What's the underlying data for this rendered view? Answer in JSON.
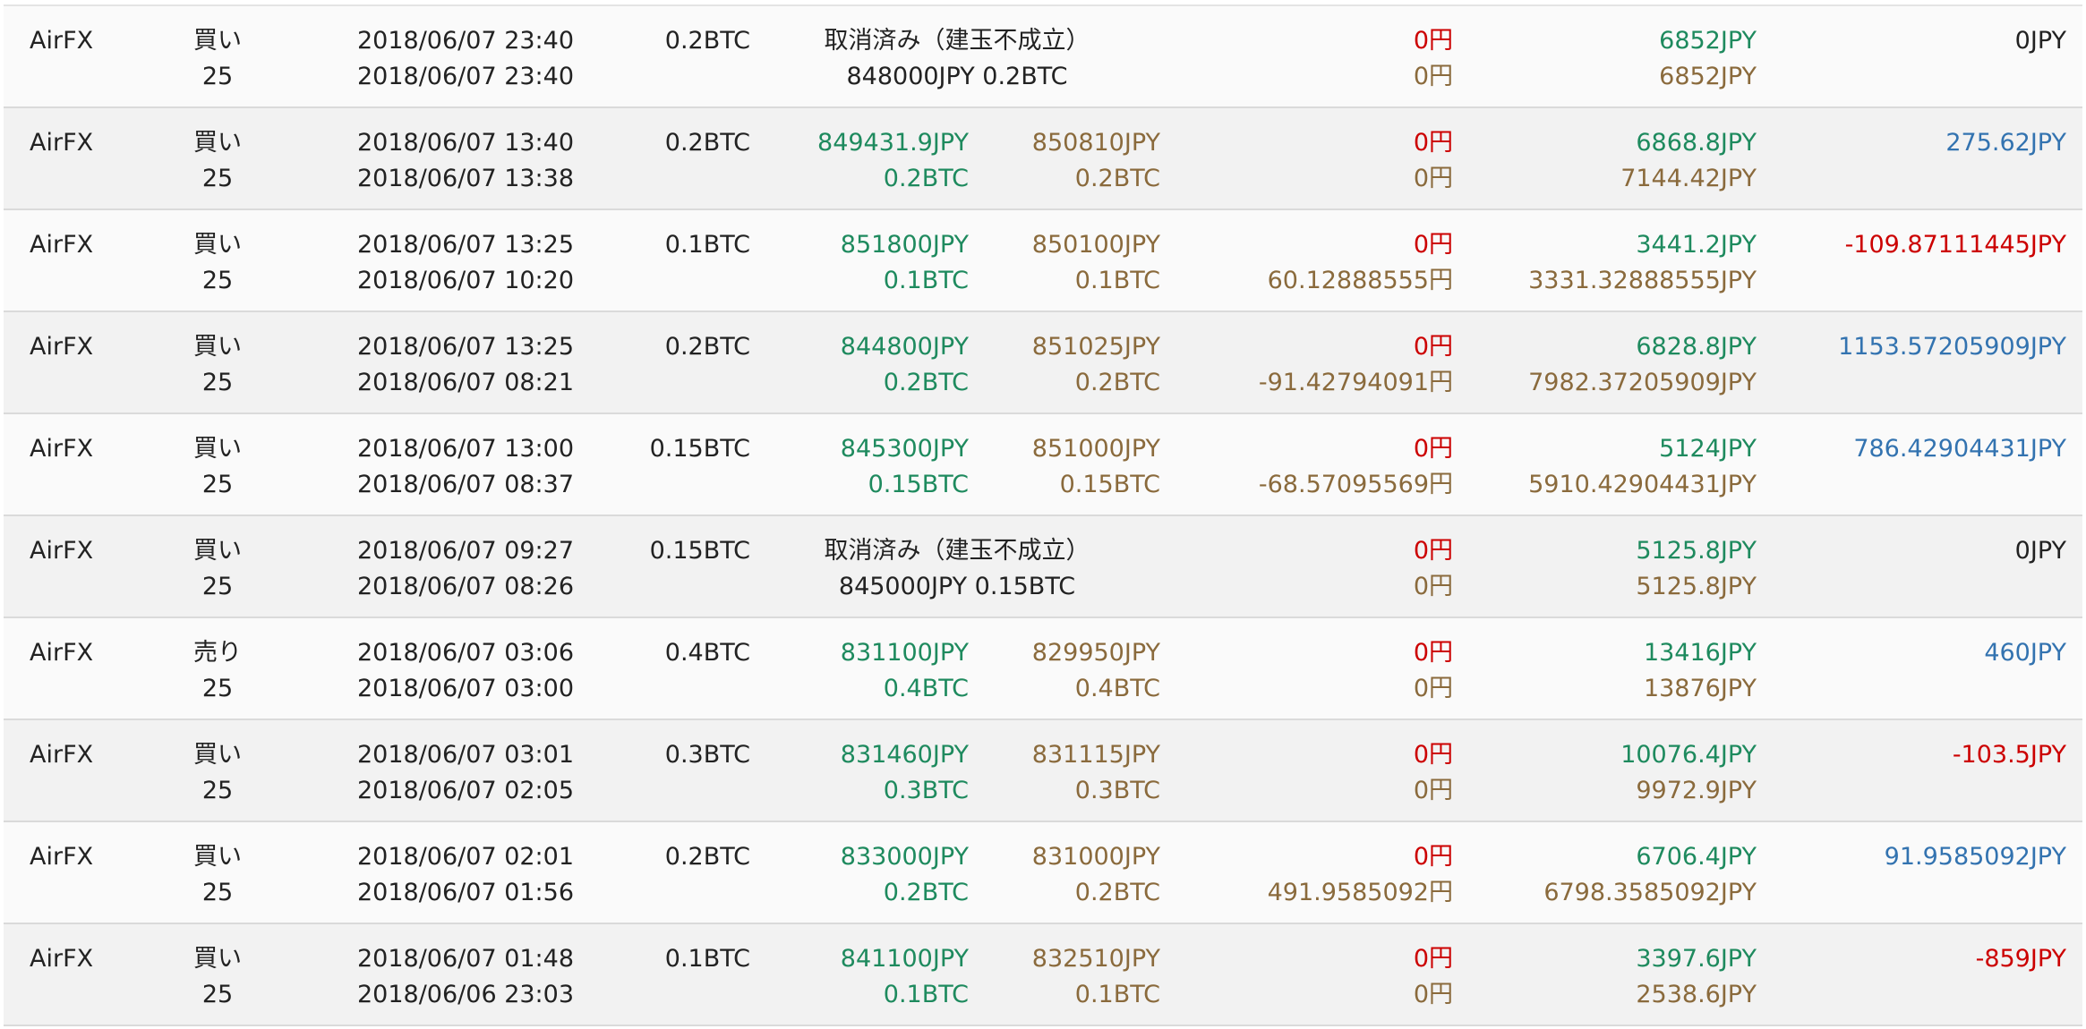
{
  "colors": {
    "open": "#1e8a5e",
    "close": "#8a6a3c",
    "loss": "#cc0000",
    "profit": "#3373b0",
    "neutral": "#222222"
  },
  "rows": [
    {
      "exchange": "AirFX",
      "side": "買い",
      "leverage": "25",
      "date1": "2018/06/07 23:40",
      "date2": "2018/06/07 23:40",
      "amount": "0.2BTC",
      "cancelled": true,
      "cancel_text": "取消済み（建玉不成立）",
      "cancel_detail": "848000JPY 0.2BTC",
      "fee1": "0円",
      "fee2": "0円",
      "margin1": "6852JPY",
      "margin2": "6852JPY",
      "pl": "0JPY",
      "pl_color": "black"
    },
    {
      "exchange": "AirFX",
      "side": "買い",
      "leverage": "25",
      "date1": "2018/06/07 13:40",
      "date2": "2018/06/07 13:38",
      "amount": "0.2BTC",
      "cancelled": false,
      "open_price": "849431.9JPY",
      "open_amt": "0.2BTC",
      "close_price": "850810JPY",
      "close_amt": "0.2BTC",
      "fee1": "0円",
      "fee2": "0円",
      "margin1": "6868.8JPY",
      "margin2": "7144.42JPY",
      "pl": "275.62JPY",
      "pl_color": "blue"
    },
    {
      "exchange": "AirFX",
      "side": "買い",
      "leverage": "25",
      "date1": "2018/06/07 13:25",
      "date2": "2018/06/07 10:20",
      "amount": "0.1BTC",
      "cancelled": false,
      "open_price": "851800JPY",
      "open_amt": "0.1BTC",
      "close_price": "850100JPY",
      "close_amt": "0.1BTC",
      "fee1": "0円",
      "fee2": "60.12888555円",
      "margin1": "3441.2JPY",
      "margin2": "3331.32888555JPY",
      "pl": "-109.87111445JPY",
      "pl_color": "red"
    },
    {
      "exchange": "AirFX",
      "side": "買い",
      "leverage": "25",
      "date1": "2018/06/07 13:25",
      "date2": "2018/06/07 08:21",
      "amount": "0.2BTC",
      "cancelled": false,
      "open_price": "844800JPY",
      "open_amt": "0.2BTC",
      "close_price": "851025JPY",
      "close_amt": "0.2BTC",
      "fee1": "0円",
      "fee2": "-91.42794091円",
      "margin1": "6828.8JPY",
      "margin2": "7982.37205909JPY",
      "pl": "1153.57205909JPY",
      "pl_color": "blue"
    },
    {
      "exchange": "AirFX",
      "side": "買い",
      "leverage": "25",
      "date1": "2018/06/07 13:00",
      "date2": "2018/06/07 08:37",
      "amount": "0.15BTC",
      "cancelled": false,
      "open_price": "845300JPY",
      "open_amt": "0.15BTC",
      "close_price": "851000JPY",
      "close_amt": "0.15BTC",
      "fee1": "0円",
      "fee2": "-68.57095569円",
      "margin1": "5124JPY",
      "margin2": "5910.42904431JPY",
      "pl": "786.42904431JPY",
      "pl_color": "blue"
    },
    {
      "exchange": "AirFX",
      "side": "買い",
      "leverage": "25",
      "date1": "2018/06/07 09:27",
      "date2": "2018/06/07 08:26",
      "amount": "0.15BTC",
      "cancelled": true,
      "cancel_text": "取消済み（建玉不成立）",
      "cancel_detail": "845000JPY 0.15BTC",
      "fee1": "0円",
      "fee2": "0円",
      "margin1": "5125.8JPY",
      "margin2": "5125.8JPY",
      "pl": "0JPY",
      "pl_color": "black"
    },
    {
      "exchange": "AirFX",
      "side": "売り",
      "leverage": "25",
      "date1": "2018/06/07 03:06",
      "date2": "2018/06/07 03:00",
      "amount": "0.4BTC",
      "cancelled": false,
      "open_price": "831100JPY",
      "open_amt": "0.4BTC",
      "close_price": "829950JPY",
      "close_amt": "0.4BTC",
      "fee1": "0円",
      "fee2": "0円",
      "margin1": "13416JPY",
      "margin2": "13876JPY",
      "pl": "460JPY",
      "pl_color": "blue"
    },
    {
      "exchange": "AirFX",
      "side": "買い",
      "leverage": "25",
      "date1": "2018/06/07 03:01",
      "date2": "2018/06/07 02:05",
      "amount": "0.3BTC",
      "cancelled": false,
      "open_price": "831460JPY",
      "open_amt": "0.3BTC",
      "close_price": "831115JPY",
      "close_amt": "0.3BTC",
      "fee1": "0円",
      "fee2": "0円",
      "margin1": "10076.4JPY",
      "margin2": "9972.9JPY",
      "pl": "-103.5JPY",
      "pl_color": "red"
    },
    {
      "exchange": "AirFX",
      "side": "買い",
      "leverage": "25",
      "date1": "2018/06/07 02:01",
      "date2": "2018/06/07 01:56",
      "amount": "0.2BTC",
      "cancelled": false,
      "open_price": "833000JPY",
      "open_amt": "0.2BTC",
      "close_price": "831000JPY",
      "close_amt": "0.2BTC",
      "fee1": "0円",
      "fee2": "491.9585092円",
      "margin1": "6706.4JPY",
      "margin2": "6798.3585092JPY",
      "pl": "91.9585092JPY",
      "pl_color": "blue"
    },
    {
      "exchange": "AirFX",
      "side": "買い",
      "leverage": "25",
      "date1": "2018/06/07 01:48",
      "date2": "2018/06/06 23:03",
      "amount": "0.1BTC",
      "cancelled": false,
      "open_price": "841100JPY",
      "open_amt": "0.1BTC",
      "close_price": "832510JPY",
      "close_amt": "0.1BTC",
      "fee1": "0円",
      "fee2": "0円",
      "margin1": "3397.6JPY",
      "margin2": "2538.6JPY",
      "pl": "-859JPY",
      "pl_color": "red"
    }
  ]
}
